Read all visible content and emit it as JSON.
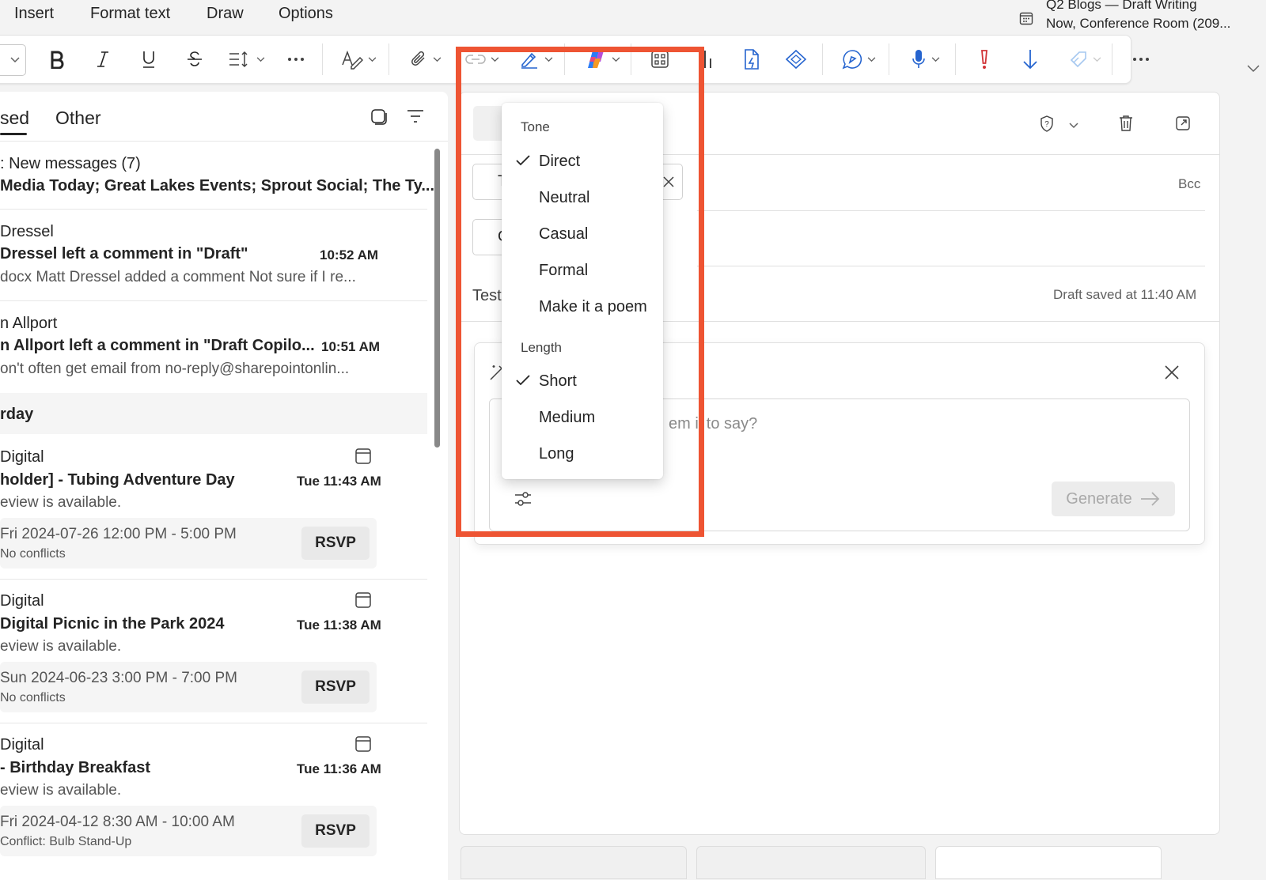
{
  "menu": {
    "items": [
      "Insert",
      "Format text",
      "Draw",
      "Options"
    ]
  },
  "meeting": {
    "title": "Q2 Blogs — Draft Writing",
    "subtitle": "Now, Conference Room (209..."
  },
  "list": {
    "tabs": {
      "focused": "sed",
      "other": "Other"
    },
    "group": {
      "title": ": New messages (7)",
      "senders": " Media Today; Great Lakes Events; Sprout Social; The Ty..."
    },
    "messages": [
      {
        "sender": "Dressel",
        "subject": "Dressel left a comment in \"Draft\"",
        "time": "10:52 AM",
        "preview": "docx Matt Dressel added a comment Not sure if I re..."
      },
      {
        "sender": "n Allport",
        "subject": "n Allport left a comment in \"Draft Copilo...",
        "time": "10:51 AM",
        "preview": "on't often get email from no-reply@sharepointonlin..."
      }
    ],
    "day_section": "rday",
    "events": [
      {
        "sender": "Digital",
        "subject": "holder] - Tubing Adventure Day",
        "time": "Tue 11:43 AM",
        "preview": "eview is available.",
        "when": "Fri 2024-07-26 12:00 PM - 5:00 PM",
        "conflict": "No conflicts",
        "rsvp": "RSVP"
      },
      {
        "sender": "Digital",
        "subject": "Digital Picnic in the Park 2024",
        "time": "Tue 11:38 AM",
        "preview": "eview is available.",
        "when": "Sun 2024-06-23 3:00 PM - 7:00 PM",
        "conflict": "No conflicts",
        "rsvp": "RSVP"
      },
      {
        "sender": "Digital",
        "subject": "- Birthday Breakfast",
        "time": "Tue 11:36 AM",
        "preview": "eview is available.",
        "when": "Fri 2024-04-12 8:30 AM - 10:00 AM",
        "conflict": "Conflict: Bulb Stand-Up",
        "rsvp": "RSVP"
      }
    ]
  },
  "compose": {
    "bcc": "Bcc",
    "subject_partial": "Test",
    "draft_status": "Draft saved at 11:40 AM",
    "to_initial": "T",
    "cc_initial": "C",
    "prompt_placeholder": "em  il to say?",
    "generate_label": "Generate"
  },
  "dropdown": {
    "tone_header": "Tone",
    "tone_options": [
      "Direct",
      "Neutral",
      "Casual",
      "Formal",
      "Make it a poem"
    ],
    "tone_selected": "Direct",
    "length_header": "Length",
    "length_options": [
      "Short",
      "Medium",
      "Long"
    ],
    "length_selected": "Short"
  },
  "colors": {
    "highlight": "#ee5433",
    "accent_blue": "#2564cf",
    "importance_red": "#d13438"
  }
}
